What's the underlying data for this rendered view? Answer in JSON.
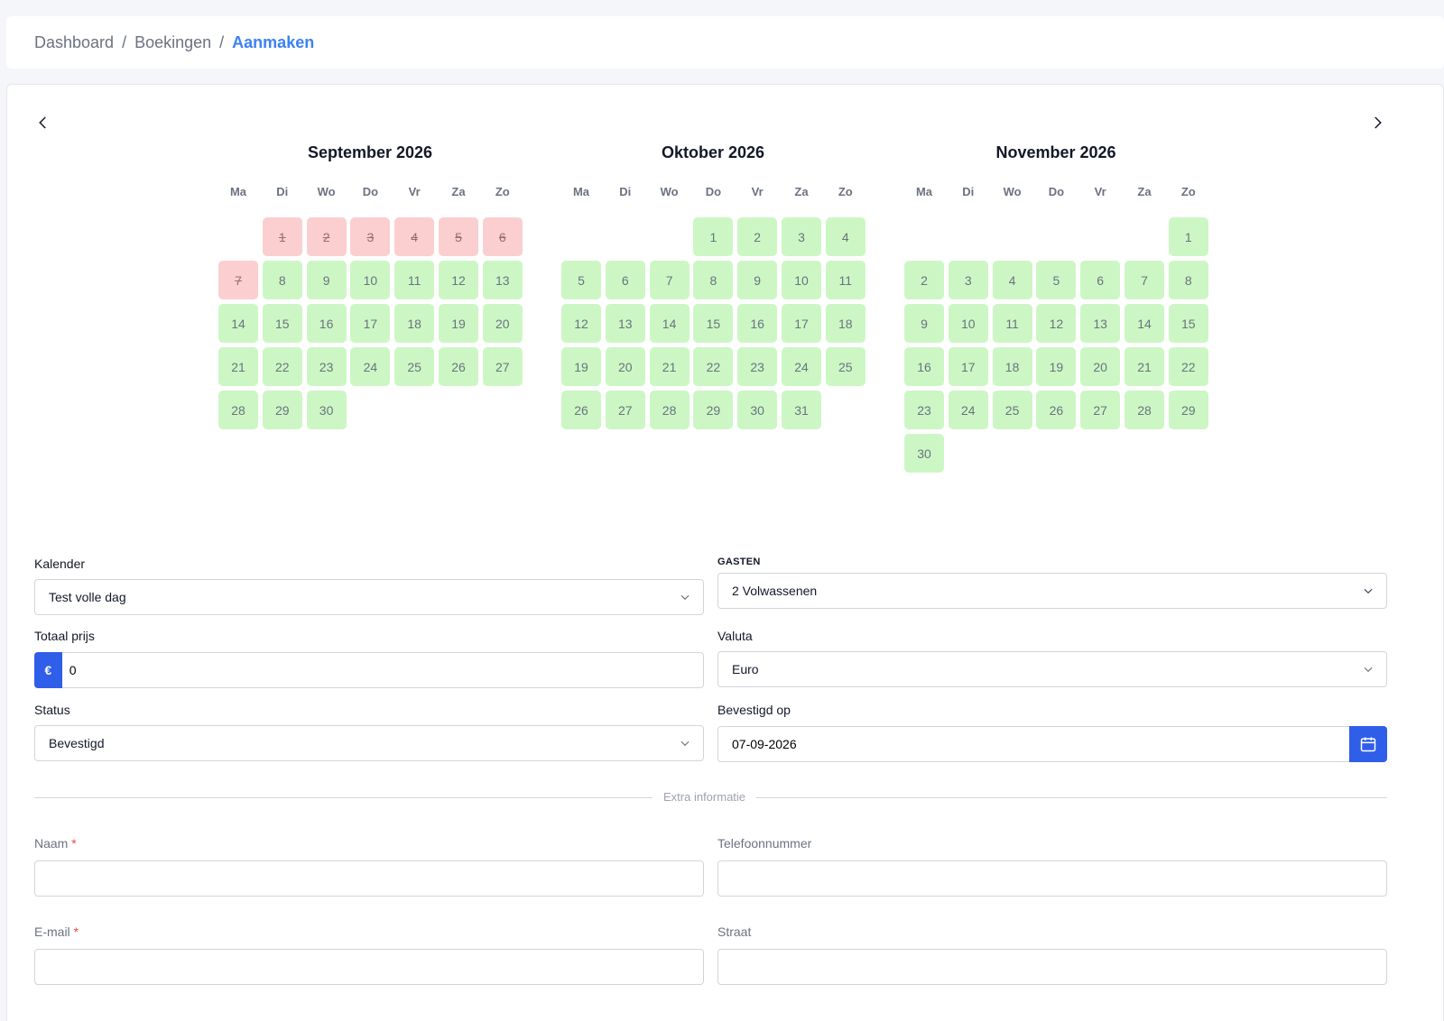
{
  "breadcrumb": {
    "items": [
      "Dashboard",
      "Boekingen"
    ],
    "active": "Aanmaken",
    "separator": "/"
  },
  "calendar": {
    "weekdays": [
      "Ma",
      "Di",
      "Wo",
      "Do",
      "Vr",
      "Za",
      "Zo"
    ],
    "months": [
      {
        "title": "September 2026",
        "offset": 1,
        "days": 30,
        "booked": [
          1,
          2,
          3,
          4,
          5,
          6,
          7
        ]
      },
      {
        "title": "Oktober 2026",
        "offset": 3,
        "days": 31,
        "booked": []
      },
      {
        "title": "November 2026",
        "offset": 6,
        "days": 30,
        "booked": []
      }
    ],
    "colors": {
      "available": "#ccf7c4",
      "booked": "#fbcfcf"
    }
  },
  "form": {
    "kalender": {
      "label": "Kalender",
      "value": "Test volle dag"
    },
    "gasten": {
      "label": "GASTEN",
      "value": "2 Volwassenen"
    },
    "totaal_prijs": {
      "label": "Totaal prijs",
      "currency_symbol": "€",
      "value": "0"
    },
    "valuta": {
      "label": "Valuta",
      "value": "Euro"
    },
    "status": {
      "label": "Status",
      "value": "Bevestigd"
    },
    "bevestigd_op": {
      "label": "Bevestigd op",
      "value": "07-09-2026"
    },
    "divider": "Extra informatie",
    "naam": {
      "label": "Naam",
      "required": "*",
      "value": ""
    },
    "telefoon": {
      "label": "Telefoonnummer",
      "value": ""
    },
    "email": {
      "label": "E-mail",
      "required": "*",
      "value": ""
    },
    "straat": {
      "label": "Straat",
      "value": ""
    }
  },
  "accent": "#2f5ee8"
}
